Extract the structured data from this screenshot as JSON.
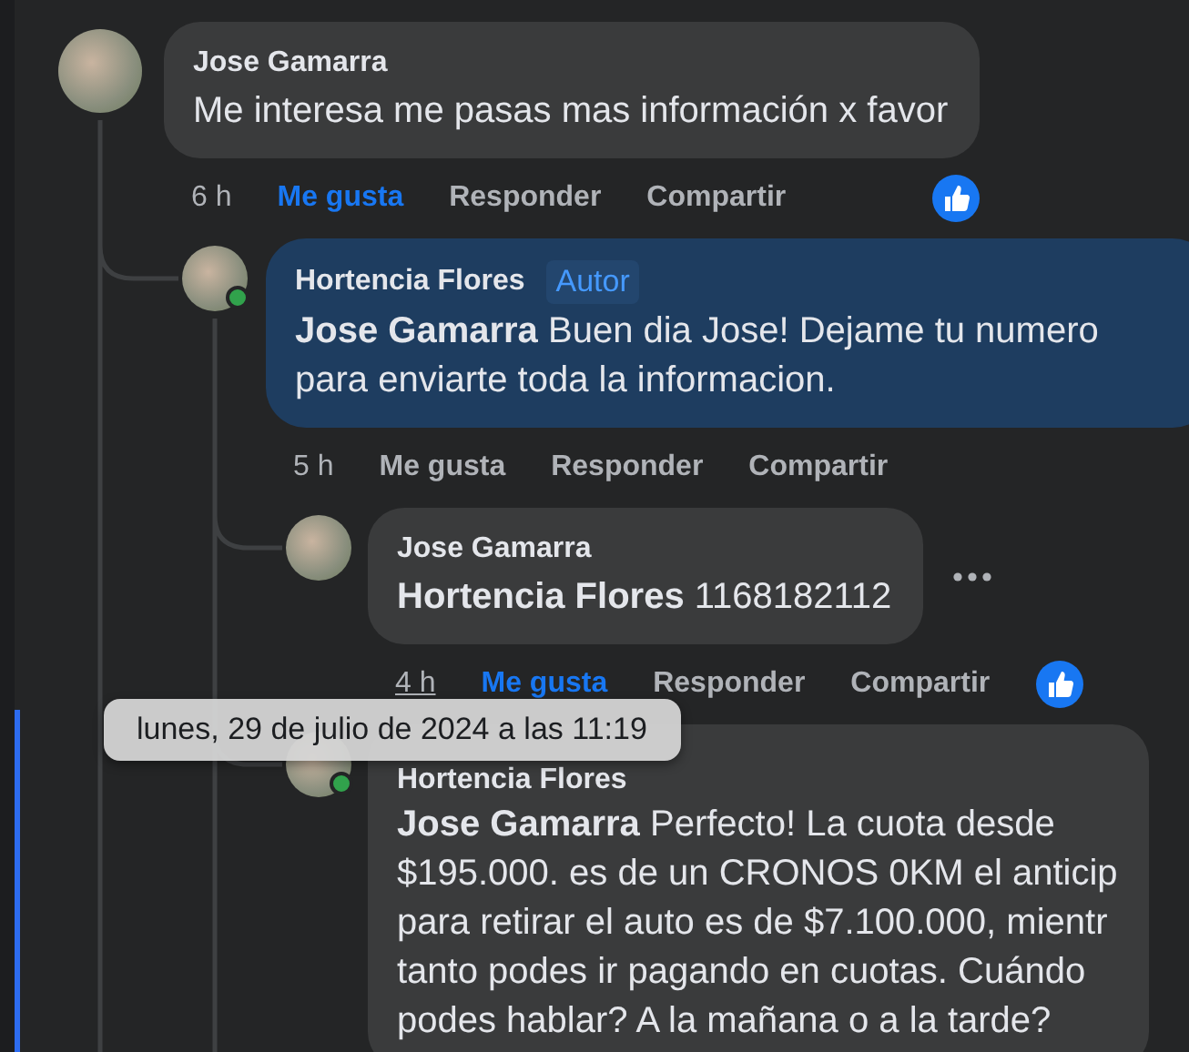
{
  "thread": [
    {
      "author": "Jose Gamarra",
      "highlighted": false,
      "text": [
        "Me interesa me pasas mas información x favor"
      ],
      "time": "6 h",
      "time_hovered": false,
      "liked": true,
      "actions": [
        "Me gusta",
        "Responder",
        "Compartir"
      ],
      "like_reaction": true,
      "children": [
        {
          "author": "Hortencia Flores",
          "badge": "Autor",
          "online": true,
          "highlighted": true,
          "text": [
            "**Jose Gamarra** Buen dia Jose! Dejame tu numero para enviarte toda la informacion."
          ],
          "time": "5 h",
          "time_hovered": false,
          "liked": false,
          "actions": [
            "Me gusta",
            "Responder",
            "Compartir"
          ],
          "children": [
            {
              "author": "Jose Gamarra",
              "highlighted": false,
              "text": [
                "**Hortencia Flores** 1168182112"
              ],
              "time": "4 h",
              "time_hovered": true,
              "liked": true,
              "actions": [
                "Me gusta",
                "Responder",
                "Compartir"
              ],
              "like_reaction": true,
              "more_button": true
            },
            {
              "author": "Hortencia Flores",
              "online": true,
              "highlighted": false,
              "text": [
                "**Jose Gamarra** Perfecto! La cuota desde",
                "$195.000. es de un CRONOS 0KM el anticip",
                "para retirar el auto es de $7.100.000, mientr",
                "tanto podes ir pagando en cuotas. Cuándo",
                "podes hablar? A la mañana o a la tarde?"
              ]
            }
          ]
        }
      ]
    }
  ],
  "tooltip": "lunes, 29 de julio de 2024 a las 11:19"
}
